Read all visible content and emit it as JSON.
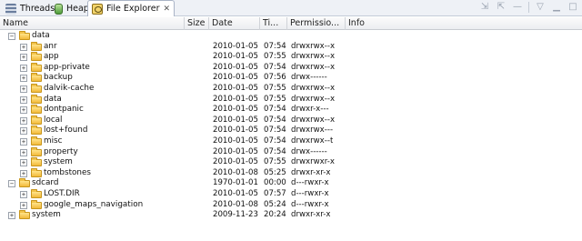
{
  "tabs": [
    {
      "label": "Threads",
      "icon": "threads-icon",
      "active": false
    },
    {
      "label": "Heap",
      "icon": "heap-icon",
      "active": false
    },
    {
      "label": "File Explorer",
      "icon": "file-explorer-icon",
      "active": true,
      "close": "✕"
    }
  ],
  "toolbar": {
    "icons": [
      "pull-file-icon",
      "push-file-icon",
      "delete-icon",
      "minimize-icon",
      "view-menu-icon",
      "maximize-icon"
    ]
  },
  "columns": [
    "Name",
    "Size",
    "Date",
    "Ti...",
    "Permissio...",
    "Info"
  ],
  "rows": [
    {
      "name": "data",
      "size": "",
      "date": "",
      "time": "",
      "perm": "",
      "depth": 0,
      "expanded": true
    },
    {
      "name": "anr",
      "size": "",
      "date": "2010-01-05",
      "time": "07:54",
      "perm": "drwxrwx--x",
      "depth": 1,
      "expanded": false
    },
    {
      "name": "app",
      "size": "",
      "date": "2010-01-05",
      "time": "07:55",
      "perm": "drwxrwx--x",
      "depth": 1,
      "expanded": false
    },
    {
      "name": "app-private",
      "size": "",
      "date": "2010-01-05",
      "time": "07:54",
      "perm": "drwxrwx--x",
      "depth": 1,
      "expanded": false
    },
    {
      "name": "backup",
      "size": "",
      "date": "2010-01-05",
      "time": "07:56",
      "perm": "drwx------",
      "depth": 1,
      "expanded": false
    },
    {
      "name": "dalvik-cache",
      "size": "",
      "date": "2010-01-05",
      "time": "07:55",
      "perm": "drwxrwx--x",
      "depth": 1,
      "expanded": false
    },
    {
      "name": "data",
      "size": "",
      "date": "2010-01-05",
      "time": "07:55",
      "perm": "drwxrwx--x",
      "depth": 1,
      "expanded": false
    },
    {
      "name": "dontpanic",
      "size": "",
      "date": "2010-01-05",
      "time": "07:54",
      "perm": "drwxr-x---",
      "depth": 1,
      "expanded": false
    },
    {
      "name": "local",
      "size": "",
      "date": "2010-01-05",
      "time": "07:54",
      "perm": "drwxrwx--x",
      "depth": 1,
      "expanded": false
    },
    {
      "name": "lost+found",
      "size": "",
      "date": "2010-01-05",
      "time": "07:54",
      "perm": "drwxrwx---",
      "depth": 1,
      "expanded": false
    },
    {
      "name": "misc",
      "size": "",
      "date": "2010-01-05",
      "time": "07:54",
      "perm": "drwxrwx--t",
      "depth": 1,
      "expanded": false
    },
    {
      "name": "property",
      "size": "",
      "date": "2010-01-05",
      "time": "07:54",
      "perm": "drwx------",
      "depth": 1,
      "expanded": false
    },
    {
      "name": "system",
      "size": "",
      "date": "2010-01-05",
      "time": "07:55",
      "perm": "drwxrwxr-x",
      "depth": 1,
      "expanded": false
    },
    {
      "name": "tombstones",
      "size": "",
      "date": "2010-01-08",
      "time": "05:25",
      "perm": "drwxr-xr-x",
      "depth": 1,
      "expanded": false
    },
    {
      "name": "sdcard",
      "size": "",
      "date": "1970-01-01",
      "time": "00:00",
      "perm": "d---rwxr-x",
      "depth": 0,
      "expanded": true
    },
    {
      "name": "LOST.DIR",
      "size": "",
      "date": "2010-01-05",
      "time": "07:57",
      "perm": "d---rwxr-x",
      "depth": 1,
      "expanded": false
    },
    {
      "name": "google_maps_navigation",
      "size": "",
      "date": "2010-01-08",
      "time": "05:24",
      "perm": "d---rwxr-x",
      "depth": 1,
      "expanded": false
    },
    {
      "name": "system",
      "size": "",
      "date": "2009-11-23",
      "time": "20:24",
      "perm": "drwxr-xr-x",
      "depth": 0,
      "expanded": false
    }
  ]
}
